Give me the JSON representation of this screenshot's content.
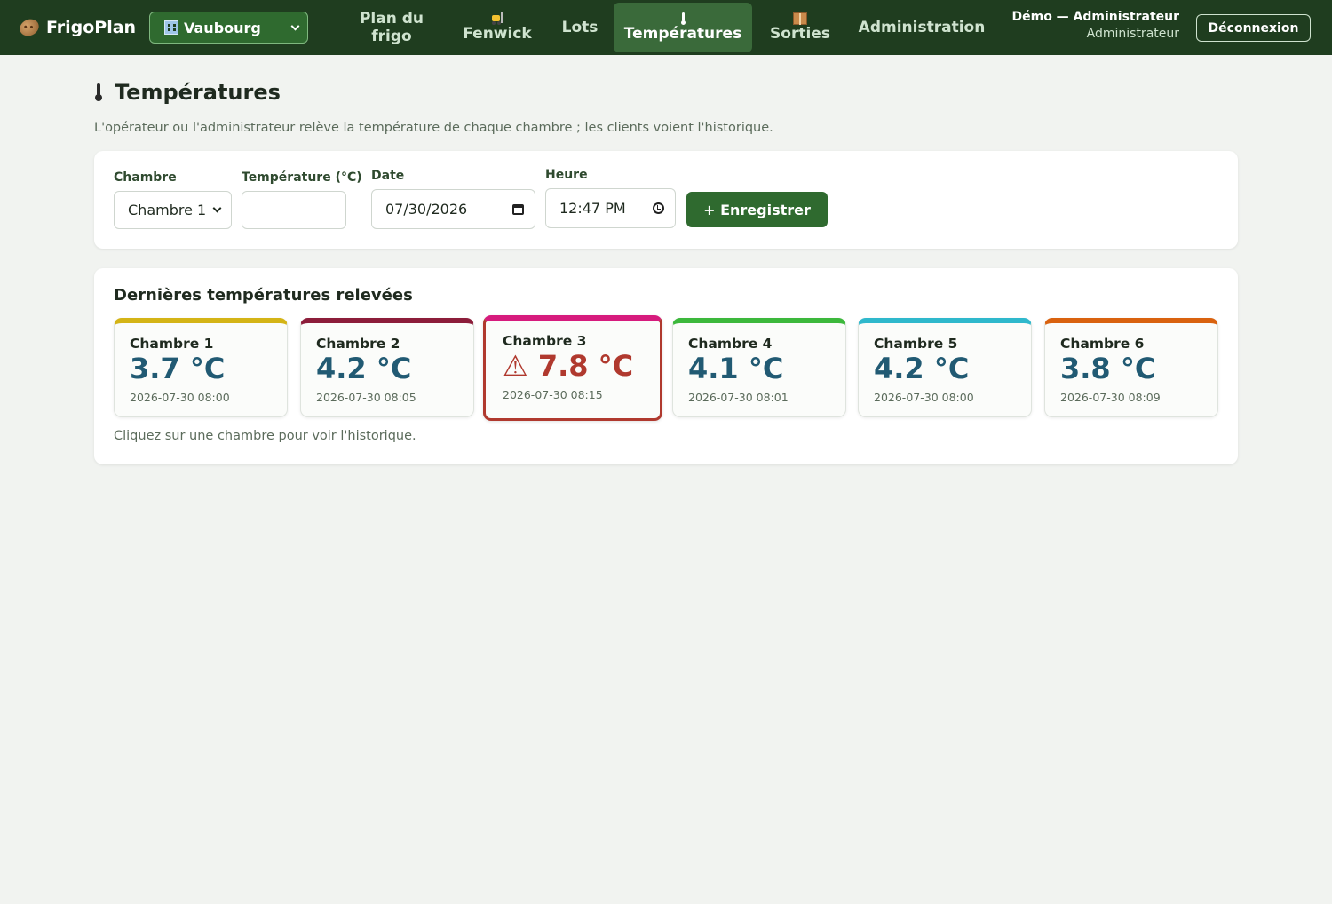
{
  "app": {
    "name": "FrigoPlan"
  },
  "site_selector": {
    "value": "Vaubourg"
  },
  "nav": {
    "plan": "Plan du frigo",
    "fenwick": "Fenwick",
    "lots": "Lots",
    "temperatures": "Températures",
    "sorties": "Sorties",
    "administration": "Administration",
    "active": "temperatures"
  },
  "user": {
    "name": "Démo — Administrateur",
    "role": "Administrateur",
    "logout_label": "Déconnexion"
  },
  "page": {
    "title": "Températures",
    "subtitle": "L'opérateur ou l'administrateur relève la température de chaque chambre ; les clients voient l'historique."
  },
  "form": {
    "room_label": "Chambre",
    "room_value": "Chambre 1",
    "temp_label": "Température (°C)",
    "temp_value": "",
    "date_label": "Date",
    "date_value": "07/30/2026",
    "time_label": "Heure",
    "time_value": "12:47 PM",
    "save_label": "+ Enregistrer"
  },
  "latest": {
    "title": "Dernières températures relevées",
    "hint": "Cliquez sur une chambre pour voir l'historique.",
    "rooms": [
      {
        "name": "Chambre 1",
        "temp": "3.7 °C",
        "time": "2026-07-30 08:00",
        "color": "#d4b416",
        "alert": false
      },
      {
        "name": "Chambre 2",
        "temp": "4.2 °C",
        "time": "2026-07-30 08:05",
        "color": "#8c1d3a",
        "alert": false
      },
      {
        "name": "Chambre 3",
        "temp": "⚠ 7.8 °C",
        "time": "2026-07-30 08:15",
        "color": "#d61b7d",
        "alert": true
      },
      {
        "name": "Chambre 4",
        "temp": "4.1 °C",
        "time": "2026-07-30 08:01",
        "color": "#3cb83c",
        "alert": false
      },
      {
        "name": "Chambre 5",
        "temp": "4.2 °C",
        "time": "2026-07-30 08:00",
        "color": "#2fb8cc",
        "alert": false
      },
      {
        "name": "Chambre 6",
        "temp": "3.8 °C",
        "time": "2026-07-30 08:09",
        "color": "#d9620f",
        "alert": false
      }
    ]
  }
}
